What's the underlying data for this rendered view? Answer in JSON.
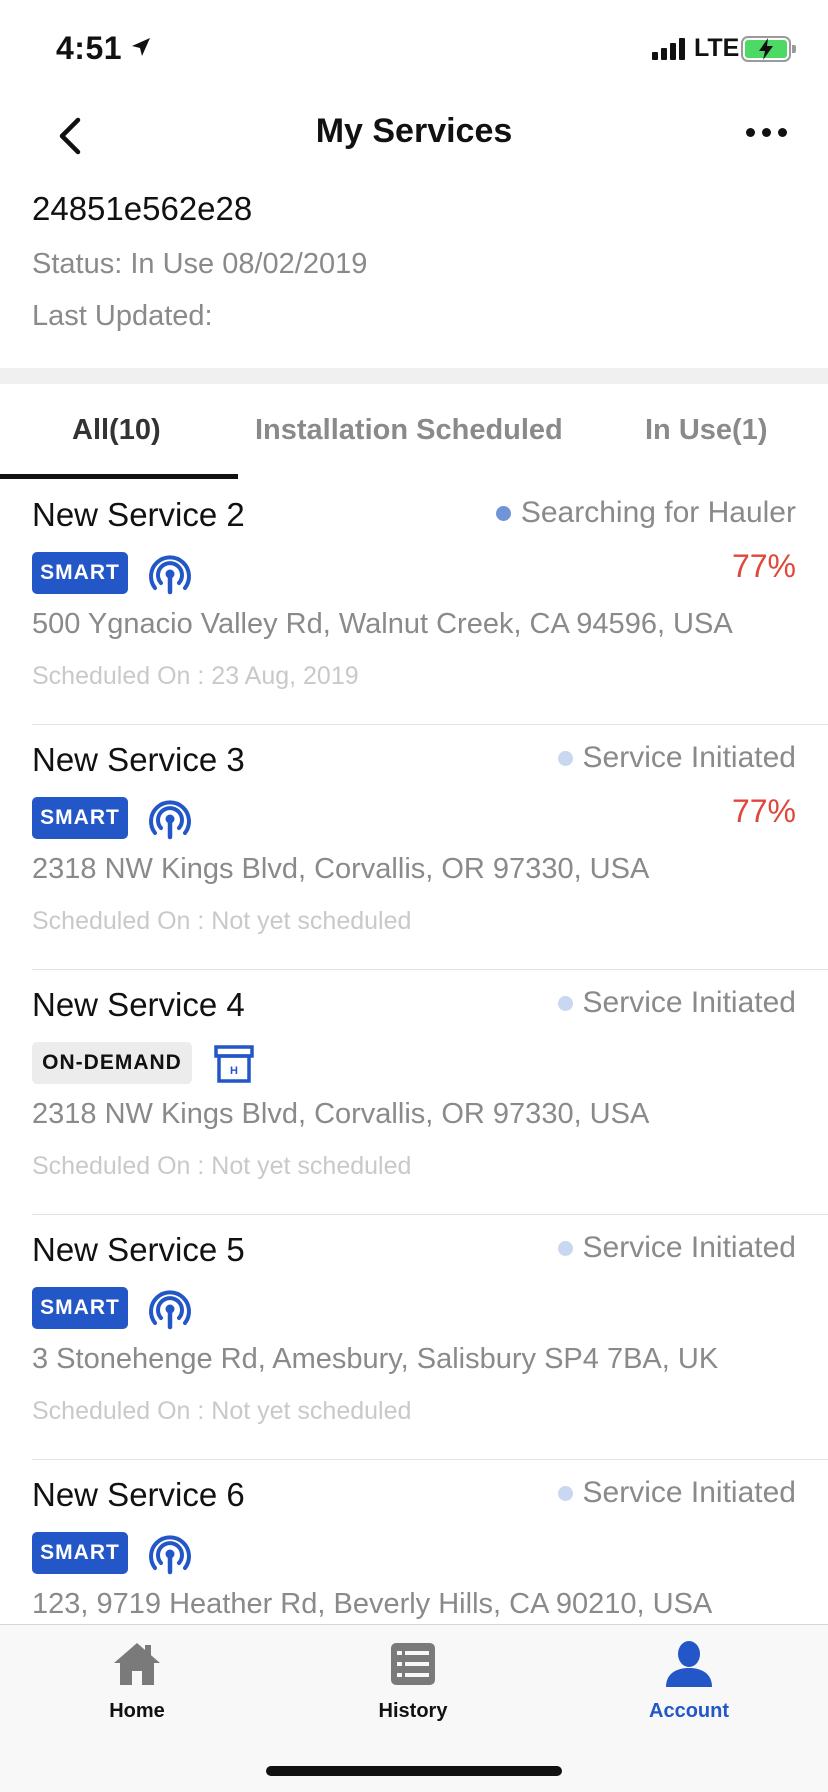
{
  "status_bar": {
    "time": "4:51",
    "network": "LTE"
  },
  "nav": {
    "title": "My Services"
  },
  "header": {
    "id": "24851e562e28",
    "status": "Status: In Use 08/02/2019",
    "last_updated": "Last Updated:"
  },
  "tabs": [
    {
      "label": "All(10)",
      "active": true
    },
    {
      "label": "Installation Scheduled",
      "active": false
    },
    {
      "label": "In Use(1)",
      "active": false
    }
  ],
  "services": [
    {
      "name": "New Service 2",
      "state": "Searching for Hauler",
      "state_dot": "#6f95d6",
      "badge": "SMART",
      "icon": "sensor-signal-icon",
      "percent": "77%",
      "address": "500 Ygnacio Valley Rd, Walnut Creek, CA 94596, USA",
      "scheduled": "Scheduled On : 23 Aug, 2019"
    },
    {
      "name": "New Service 3",
      "state": "Service Initiated",
      "state_dot": "#c9d7f0",
      "badge": "SMART",
      "icon": "sensor-signal-icon",
      "percent": "77%",
      "address": "2318 NW Kings Blvd, Corvallis, OR 97330, USA",
      "scheduled": "Scheduled On : Not yet scheduled"
    },
    {
      "name": "New Service 4",
      "state": "Service Initiated",
      "state_dot": "#c9d7f0",
      "badge": "ON-DEMAND",
      "icon": "dumpster-icon",
      "percent": "",
      "address": "2318 NW Kings Blvd, Corvallis, OR 97330, USA",
      "scheduled": "Scheduled On : Not yet scheduled"
    },
    {
      "name": "New Service 5",
      "state": "Service Initiated",
      "state_dot": "#c9d7f0",
      "badge": "SMART",
      "icon": "sensor-signal-icon",
      "percent": "",
      "address": "3 Stonehenge Rd, Amesbury, Salisbury SP4 7BA, UK",
      "scheduled": "Scheduled On : Not yet scheduled"
    },
    {
      "name": "New Service 6",
      "state": "Service Initiated",
      "state_dot": "#c9d7f0",
      "badge": "SMART",
      "icon": "sensor-signal-icon",
      "percent": "",
      "address": "123, 9719 Heather Rd, Beverly Hills, CA 90210, USA",
      "scheduled": ""
    }
  ],
  "tabbar": [
    {
      "label": "Home",
      "icon": "home-icon",
      "active": false
    },
    {
      "label": "History",
      "icon": "history-list-icon",
      "active": false
    },
    {
      "label": "Account",
      "icon": "account-person-icon",
      "active": true
    }
  ],
  "colors": {
    "accent": "#2356c7",
    "percent": "#e0473b",
    "muted": "#8a8a8a"
  }
}
